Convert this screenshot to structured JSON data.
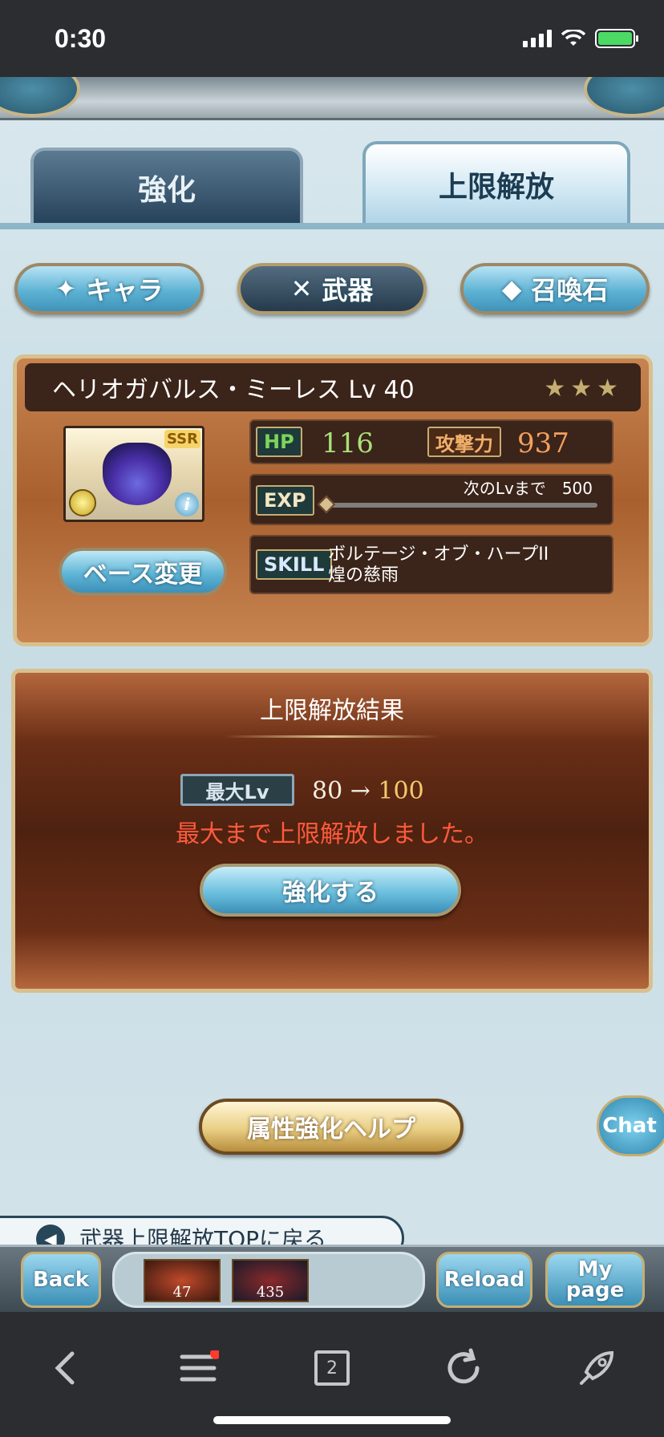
{
  "status_bar": {
    "time": "0:30"
  },
  "tabs": [
    {
      "label": "強化"
    },
    {
      "label": "上限解放"
    }
  ],
  "categories": [
    {
      "label": "キャラ"
    },
    {
      "label": "武器"
    },
    {
      "label": "召喚石"
    }
  ],
  "weapon": {
    "name_line": "ヘリオガバルス・ミーレス Lv 40",
    "stars": "★★★",
    "rarity": "SSR",
    "hp_label": "HP",
    "hp": "116",
    "atk_label": "攻撃力",
    "atk": "937",
    "exp_label": "EXP",
    "exp_next": "次のLvまで　500",
    "exp_progress": 0,
    "skill_label": "SKILL",
    "skill_line1": "ボルテージ・オブ・ハープII",
    "skill_line2": "煌の慈雨",
    "base_change": "ベース変更",
    "info_icon": "i"
  },
  "result": {
    "title": "上限解放結果",
    "max_lv_label": "最大Lv",
    "max_lv_from": "80",
    "arrow": "→",
    "max_lv_to": "100",
    "message": "最大まで上限解放しました。",
    "enhance_button": "強化する"
  },
  "help_button": "属性強化ヘルプ",
  "chat_button": "Chat",
  "back_to_top": "武器上限解放TOPに戻る",
  "bottom_bar": {
    "back": "Back",
    "quest1_count": "47",
    "quest2_count": "435",
    "reload": "Reload",
    "mypage_line1": "My",
    "mypage_line2": "page"
  },
  "browser": {
    "tab_count": "2"
  },
  "colors": {
    "hp": "#a9e07a",
    "atk": "#f3a060",
    "message": "#ff5a3c",
    "max_to": "#f3c96e"
  }
}
